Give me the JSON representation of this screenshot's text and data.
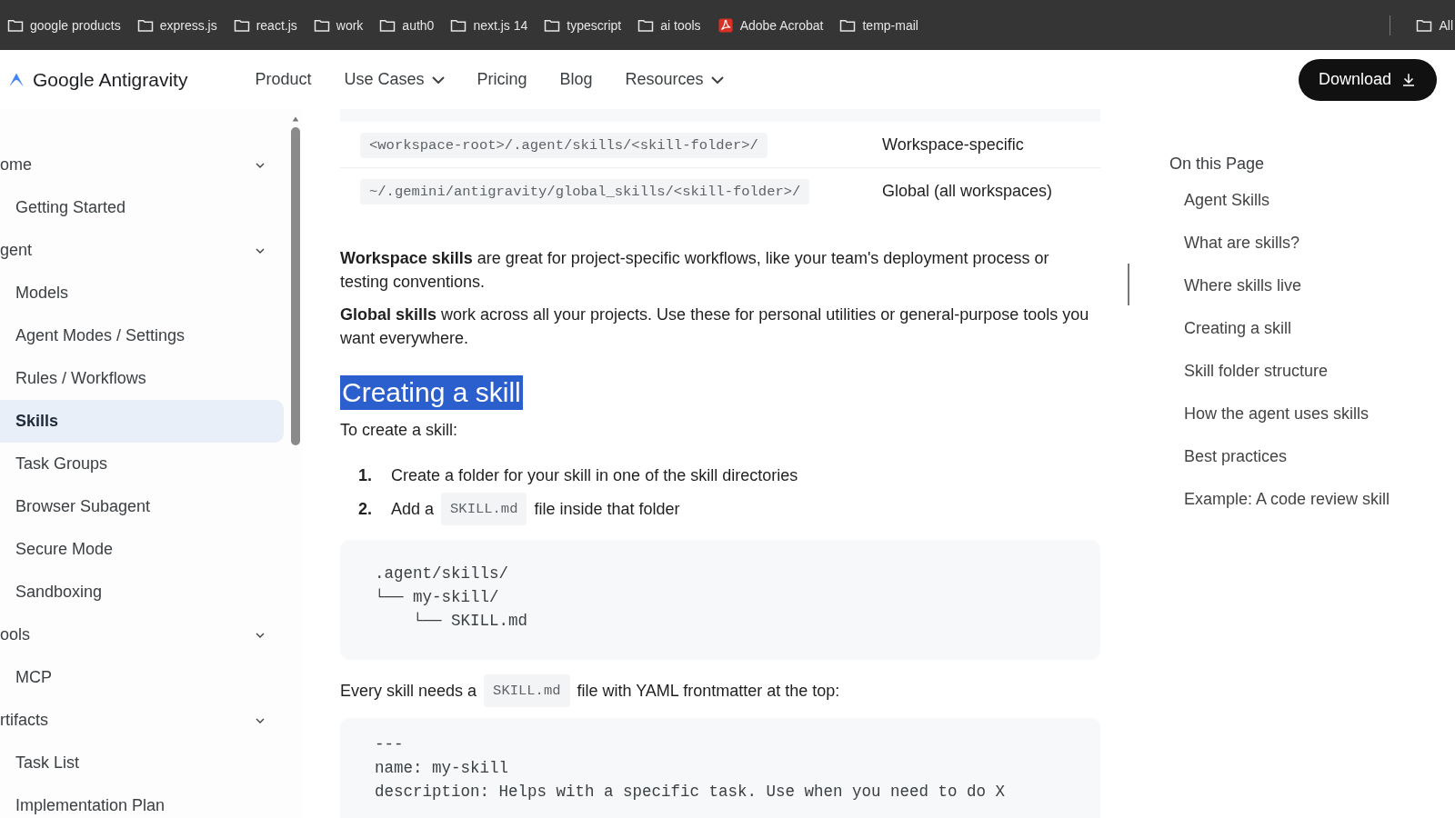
{
  "bookmarks": [
    {
      "label": "google products",
      "kind": "folder"
    },
    {
      "label": "express.js",
      "kind": "folder"
    },
    {
      "label": "react.js",
      "kind": "folder"
    },
    {
      "label": "work",
      "kind": "folder"
    },
    {
      "label": "auth0",
      "kind": "folder"
    },
    {
      "label": "next.js 14",
      "kind": "folder"
    },
    {
      "label": "typescript",
      "kind": "folder"
    },
    {
      "label": "ai tools",
      "kind": "folder"
    },
    {
      "label": "Adobe Acrobat",
      "kind": "pdf"
    },
    {
      "label": "temp-mail",
      "kind": "folder"
    }
  ],
  "all_bookmarks": {
    "label": "All"
  },
  "nav": {
    "logo": "Google Antigravity",
    "links": [
      {
        "label": "Product",
        "dropdown": false
      },
      {
        "label": "Use Cases",
        "dropdown": true
      },
      {
        "label": "Pricing",
        "dropdown": false
      },
      {
        "label": "Blog",
        "dropdown": false
      },
      {
        "label": "Resources",
        "dropdown": true
      }
    ],
    "download": "Download"
  },
  "sidebar": {
    "groups": [
      {
        "label": "ome",
        "expanded": true,
        "children": [
          {
            "label": "Getting Started",
            "selected": false
          }
        ]
      },
      {
        "label": "gent",
        "expanded": true,
        "children": [
          {
            "label": "Models",
            "selected": false
          },
          {
            "label": "Agent Modes / Settings",
            "selected": false
          },
          {
            "label": "Rules / Workflows",
            "selected": false
          },
          {
            "label": "Skills",
            "selected": true
          },
          {
            "label": "Task Groups",
            "selected": false
          },
          {
            "label": "Browser Subagent",
            "selected": false
          },
          {
            "label": "Secure Mode",
            "selected": false
          },
          {
            "label": "Sandboxing",
            "selected": false
          }
        ]
      },
      {
        "label": "ools",
        "expanded": true,
        "children": [
          {
            "label": "MCP",
            "selected": false
          }
        ]
      },
      {
        "label": "rtifacts",
        "expanded": true,
        "children": [
          {
            "label": "Task List",
            "selected": false
          },
          {
            "label": "Implementation Plan",
            "selected": false
          }
        ]
      }
    ]
  },
  "article": {
    "table": {
      "rows": [
        {
          "path": "<workspace-root>/.agent/skills/<skill-folder>/",
          "scope": "Workspace-specific"
        },
        {
          "path": "~/.gemini/antigravity/global_skills/<skill-folder>/",
          "scope": "Global (all workspaces)"
        }
      ]
    },
    "paragraphs": [
      "**Workspace skills** are great for project-specific workflows, like your team's deployment process or testing conventions.",
      "**Global skills** work across all your projects. Use these for personal utilities or general-purpose tools you want everywhere."
    ],
    "heading": {
      "text": "Creating a skill",
      "selected": true
    },
    "intro": "To create a skill:",
    "steps": [
      {
        "number": "1.",
        "parts": [
          {
            "kind": "text",
            "text": "Create a folder for your skill in one of the skill directories"
          }
        ]
      },
      {
        "number": "2.",
        "parts": [
          {
            "kind": "text",
            "text": "Add a"
          },
          {
            "kind": "code",
            "text": "SKILL.md"
          },
          {
            "kind": "text",
            "text": "file inside that folder"
          }
        ]
      }
    ],
    "tree_code": [
      ".agent/skills/",
      "└── my-skill/",
      "    └── SKILL.md"
    ],
    "note": [
      {
        "kind": "text",
        "text": "Every skill needs a"
      },
      {
        "kind": "code",
        "text": "SKILL.md"
      },
      {
        "kind": "text",
        "text": "file with YAML frontmatter at the top:"
      }
    ],
    "yaml_code": [
      "---",
      "name: my-skill",
      "description: Helps with a specific task. Use when you need to do X"
    ]
  },
  "toc": {
    "title": "On this Page",
    "items": [
      "Agent Skills",
      "What are skills?",
      "Where skills live",
      "Creating a skill",
      "Skill folder structure",
      "How the agent uses skills",
      "Best practices",
      "Example: A code review skill"
    ]
  }
}
